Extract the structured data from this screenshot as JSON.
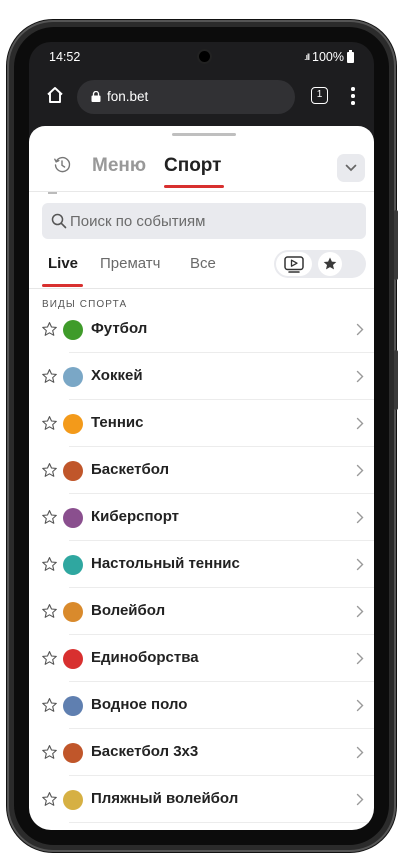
{
  "status_bar": {
    "time": "14:52",
    "signal": ".ıll",
    "battery": "100%"
  },
  "browser": {
    "url": "fon.bet",
    "tab_count": "1"
  },
  "header": {
    "menu_label": "Меню",
    "sport_label": "Спорт"
  },
  "search": {
    "placeholder": "Поиск по событиям"
  },
  "filters": {
    "tabs": [
      {
        "label": "Live",
        "active": true
      },
      {
        "label": "Прематч",
        "active": false
      },
      {
        "label": "Все",
        "active": false
      }
    ]
  },
  "section": {
    "title": "ВИДЫ СПОРТА"
  },
  "sports": [
    {
      "name": "Футбол",
      "icon": "football-icon",
      "color": "#3f9b2a",
      "glyph": "⚽"
    },
    {
      "name": "Хоккей",
      "icon": "hockey-icon",
      "color": "#7aa7c6",
      "glyph": ""
    },
    {
      "name": "Теннис",
      "icon": "tennis-icon",
      "color": "#f39a1a",
      "glyph": ""
    },
    {
      "name": "Баскетбол",
      "icon": "basketball-icon",
      "color": "#c0562a",
      "glyph": ""
    },
    {
      "name": "Киберспорт",
      "icon": "gamepad-icon",
      "color": "#8a4f8e",
      "glyph": ""
    },
    {
      "name": "Настольный теннис",
      "icon": "table-tennis-icon",
      "color": "#2fa7a0",
      "glyph": ""
    },
    {
      "name": "Волейбол",
      "icon": "volleyball-icon",
      "color": "#d98a2c",
      "glyph": ""
    },
    {
      "name": "Единоборства",
      "icon": "boxing-glove-icon",
      "color": "#d8302f",
      "glyph": ""
    },
    {
      "name": "Водное поло",
      "icon": "water-polo-icon",
      "color": "#5f7fb0",
      "glyph": ""
    },
    {
      "name": "Баскетбол 3x3",
      "icon": "basketball-3x3-icon",
      "color": "#c0562a",
      "glyph": ""
    },
    {
      "name": "Пляжный волейбол",
      "icon": "beach-volleyball-icon",
      "color": "#d6b043",
      "glyph": ""
    }
  ],
  "colors": {
    "accent": "#d8302f",
    "sheet": "#ffffff",
    "browser_bg": "#1d1d1f"
  }
}
